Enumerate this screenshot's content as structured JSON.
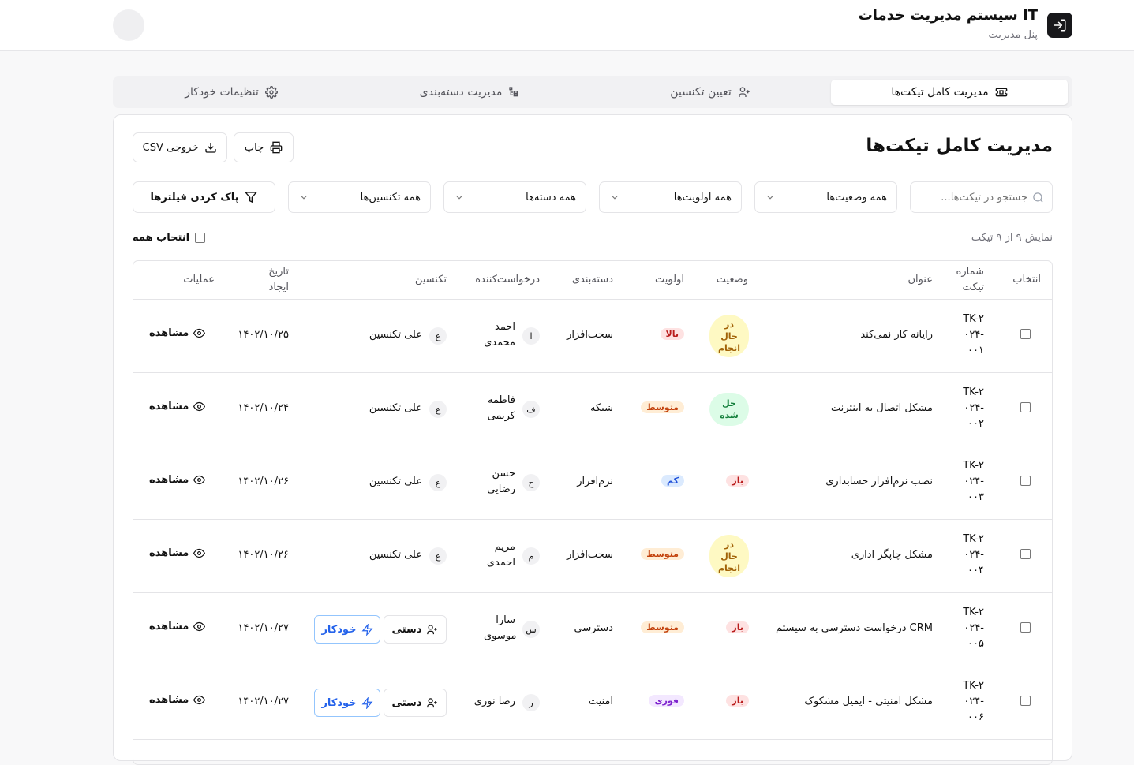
{
  "header": {
    "title": "سیستم مدیریت خدمات IT",
    "subtitle": "پنل مدیریت"
  },
  "tabs": [
    {
      "label": "مدیریت کامل تیکت‌ها",
      "icon": "ticket-icon"
    },
    {
      "label": "تعیین تکنسین",
      "icon": "user-plus-icon"
    },
    {
      "label": "مدیریت دسته‌بندی",
      "icon": "category-tree-icon"
    },
    {
      "label": "تنظیمات خودکار",
      "icon": "gear-icon"
    }
  ],
  "page": {
    "title": "مدیریت کامل تیکت‌ها",
    "print_label": "چاپ",
    "export_label": "خروجی CSV"
  },
  "filters": {
    "search_placeholder": "جستجو در تیکت‌ها...",
    "status": "همه وضعیت‌ها",
    "priority": "همه اولویت‌ها",
    "category": "همه دسته‌ها",
    "technician": "همه تکنسین‌ها",
    "clear_label": "پاک کردن فیلترها"
  },
  "summary": {
    "count_text": "نمایش ۹ از ۹ تیکت",
    "select_all_label": "انتخاب همه"
  },
  "table": {
    "headers": {
      "select": "انتخاب",
      "number": "شماره تیکت",
      "title": "عنوان",
      "status": "وضعیت",
      "priority": "اولویت",
      "category": "دسته‌بندی",
      "requester": "درخواست‌کننده",
      "technician": "تکنسین",
      "created": "تاریخ ایجاد",
      "actions": "عملیات"
    },
    "view_label": "مشاهده",
    "manual_label": "دستی",
    "auto_label": "خودکار",
    "rows": [
      {
        "number": "TK-۲۰۲۴-۰۰۱",
        "title": "رایانه کار نمی‌کند",
        "status": "در حال انجام",
        "status_type": "progress",
        "priority": "بالا",
        "priority_type": "high",
        "category": "سخت‌افزار",
        "requester_initial": "ا",
        "requester": "احمد محمدی",
        "tech_initial": "ع",
        "technician": "علی تکنسین",
        "created": "۱۴۰۲/۱۰/۲۵"
      },
      {
        "number": "TK-۲۰۲۴-۰۰۲",
        "title": "مشکل اتصال به اینترنت",
        "status": "حل شده",
        "status_type": "resolved",
        "priority": "متوسط",
        "priority_type": "medium",
        "category": "شبکه",
        "requester_initial": "ف",
        "requester": "فاطمه کریمی",
        "tech_initial": "ع",
        "technician": "علی تکنسین",
        "created": "۱۴۰۲/۱۰/۲۴"
      },
      {
        "number": "TK-۲۰۲۴-۰۰۳",
        "title": "نصب نرم‌افزار حسابداری",
        "status": "باز",
        "status_type": "open",
        "priority": "کم",
        "priority_type": "low",
        "category": "نرم‌افزار",
        "requester_initial": "ح",
        "requester": "حسن رضایی",
        "tech_initial": "ع",
        "technician": "علی تکنسین",
        "created": "۱۴۰۲/۱۰/۲۶"
      },
      {
        "number": "TK-۲۰۲۴-۰۰۴",
        "title": "مشکل چاپگر اداری",
        "status": "در حال انجام",
        "status_type": "progress",
        "priority": "متوسط",
        "priority_type": "medium",
        "category": "سخت‌افزار",
        "requester_initial": "م",
        "requester": "مریم احمدی",
        "tech_initial": "ع",
        "technician": "علی تکنسین",
        "created": "۱۴۰۲/۱۰/۲۶"
      },
      {
        "number": "TK-۲۰۲۴-۰۰۵",
        "title": "درخواست دسترسی به سیستم CRM",
        "status": "باز",
        "status_type": "open",
        "priority": "متوسط",
        "priority_type": "medium",
        "category": "دسترسی",
        "requester_initial": "س",
        "requester": "سارا موسوی",
        "tech_initial": "",
        "technician": "",
        "created": "۱۴۰۲/۱۰/۲۷"
      },
      {
        "number": "TK-۲۰۲۴-۰۰۶",
        "title": "مشکل امنیتی - ایمیل مشکوک",
        "status": "باز",
        "status_type": "open",
        "priority": "فوری",
        "priority_type": "urgent",
        "category": "امنیت",
        "requester_initial": "ر",
        "requester": "رضا نوری",
        "tech_initial": "",
        "technician": "",
        "created": "۱۴۰۲/۱۰/۲۷"
      }
    ]
  },
  "colors": {
    "status_progress_bg": "#fef9c3",
    "status_progress_fg": "#a16207",
    "status_resolved_bg": "#dcfce7",
    "status_resolved_fg": "#15803d",
    "status_open_bg": "#fee2e2",
    "status_open_fg": "#b91c1c",
    "priority_high_bg": "#fee2e2",
    "priority_high_fg": "#b91c1c",
    "priority_medium_bg": "#ffedd5",
    "priority_medium_fg": "#c2410c",
    "priority_low_bg": "#dbeafe",
    "priority_low_fg": "#1d4ed8",
    "priority_urgent_bg": "#f3e8ff",
    "priority_urgent_fg": "#7e22ce"
  }
}
